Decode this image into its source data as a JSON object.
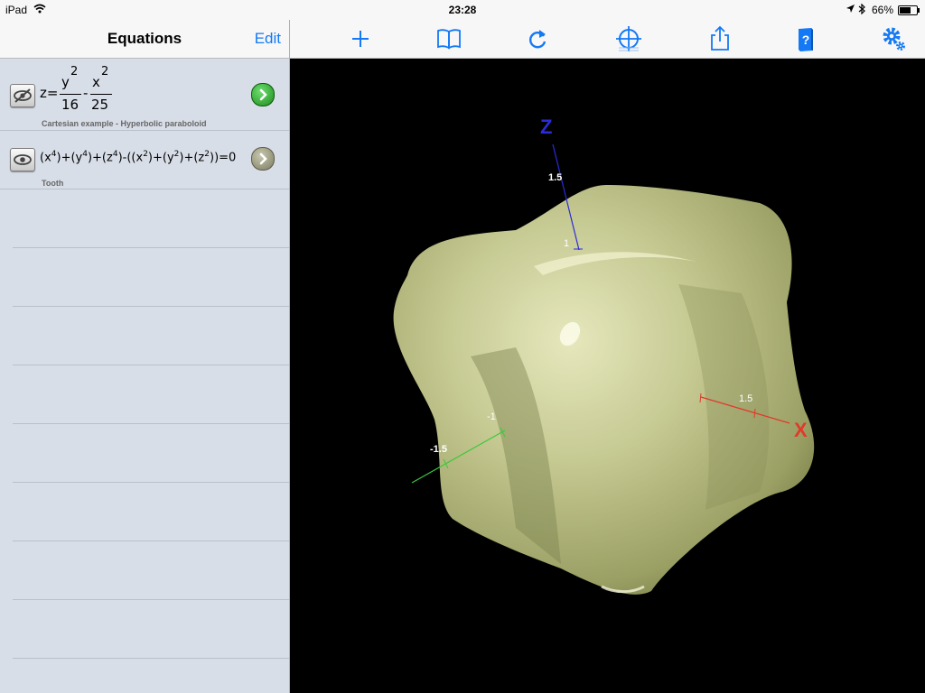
{
  "status_bar": {
    "device": "iPad",
    "time": "23:28",
    "battery_percent": "66%",
    "battery_level": 0.66,
    "icons": [
      "wifi-icon",
      "location-arrow-icon",
      "bluetooth-icon",
      "battery-icon"
    ]
  },
  "sidebar": {
    "title": "Equations",
    "edit_label": "Edit",
    "equations": [
      {
        "lhs": "z=",
        "num1": "y",
        "exp1": "2",
        "den1": "16",
        "minus": "-",
        "num2": "x",
        "exp2": "2",
        "den2": "25",
        "caption": "Cartesian example - Hyperbolic paraboloid",
        "visible": false,
        "active": true
      },
      {
        "formula_parts": [
          "(x",
          "4",
          ")+(y",
          "4",
          ")+(z",
          "4",
          ")-((x",
          "2",
          ")+(y",
          "2",
          ")+(z",
          "2",
          "))=0"
        ],
        "caption": "Tooth",
        "visible": true,
        "active": false
      }
    ]
  },
  "toolbar": {
    "buttons": [
      "add-icon",
      "book-icon",
      "refresh-icon",
      "crosshair-icon",
      "share-icon",
      "help-book-icon",
      "settings-icon"
    ]
  },
  "graph": {
    "axis_z_label": "Z",
    "axis_x_label": "X",
    "z_ticks": [
      "1.5",
      "1"
    ],
    "x_ticks": [
      "1.5"
    ],
    "y_ticks": [
      "-1",
      "-1.5"
    ],
    "colors": {
      "accent": "#1479f5",
      "surface": "#c9cc98",
      "axis_x": "#e03a2a",
      "axis_y": "#3cc83c",
      "axis_z": "#2b2bd8",
      "background": "#000000"
    }
  }
}
